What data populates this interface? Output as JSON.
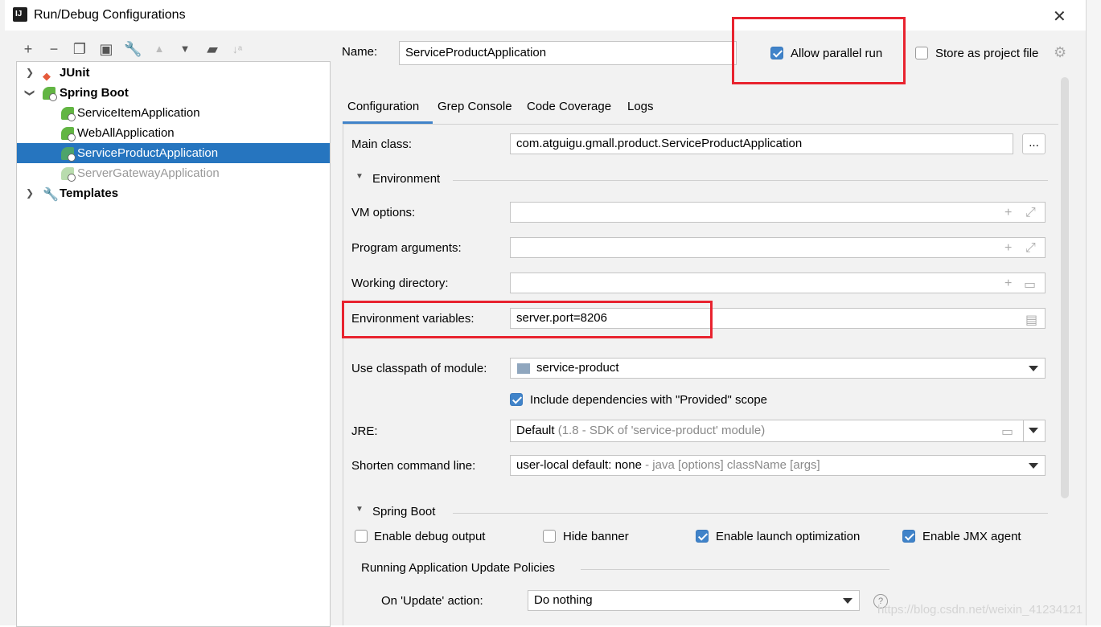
{
  "window": {
    "title": "Run/Debug Configurations"
  },
  "toolbar": {
    "icons": [
      "add-icon",
      "remove-icon",
      "copy-icon",
      "save-icon",
      "wrench-icon",
      "move-up-icon",
      "move-down-icon",
      "new-folder-icon",
      "sort-icon"
    ]
  },
  "tree": {
    "items": [
      {
        "label": "JUnit",
        "expanded": false
      },
      {
        "label": "Spring Boot",
        "expanded": true
      },
      {
        "label": "ServiceItemApplication"
      },
      {
        "label": "WebAllApplication"
      },
      {
        "label": "ServiceProductApplication",
        "selected": true
      },
      {
        "label": "ServerGatewayApplication",
        "disabled": true
      },
      {
        "label": "Templates",
        "expanded": false
      }
    ]
  },
  "header": {
    "name_label": "Name:",
    "name_value": "ServiceProductApplication",
    "allow_parallel_label": "Allow parallel run",
    "allow_parallel_checked": true,
    "store_label": "Store as project file",
    "store_checked": false
  },
  "tabs": [
    "Configuration",
    "Grep Console",
    "Code Coverage",
    "Logs"
  ],
  "config": {
    "main_class_label": "Main class:",
    "main_class_value": "com.atguigu.gmall.product.ServiceProductApplication",
    "browse_label": "...",
    "environment_section": "Environment",
    "vm_options_label": "VM options:",
    "program_args_label": "Program arguments:",
    "working_dir_label": "Working directory:",
    "env_vars_label": "Environment variables:",
    "env_vars_value": "server.port=8206",
    "classpath_label": "Use classpath of module:",
    "classpath_value": "service-product",
    "include_deps_label": "Include dependencies with \"Provided\" scope",
    "include_deps_checked": true,
    "jre_label": "JRE:",
    "jre_value": "Default",
    "jre_detail": "(1.8 - SDK of 'service-product' module)",
    "shorten_label": "Shorten command line:",
    "shorten_value": "user-local default: none",
    "shorten_detail": "- java [options] className [args]",
    "spring_section": "Spring Boot",
    "debug_output_label": "Enable debug output",
    "debug_output_checked": false,
    "hide_banner_label": "Hide banner",
    "hide_banner_checked": false,
    "launch_opt_label": "Enable launch optimization",
    "launch_opt_checked": true,
    "jmx_label": "Enable JMX agent",
    "jmx_checked": true,
    "update_policies_label": "Running Application Update Policies",
    "on_update_label": "On 'Update' action:",
    "on_update_value": "Do nothing"
  },
  "watermark": "https://blog.csdn.net/weixin_41234121",
  "colors": {
    "selection": "#2675bf",
    "checkbox": "#4083c9",
    "highlight_box": "#e8232f"
  }
}
